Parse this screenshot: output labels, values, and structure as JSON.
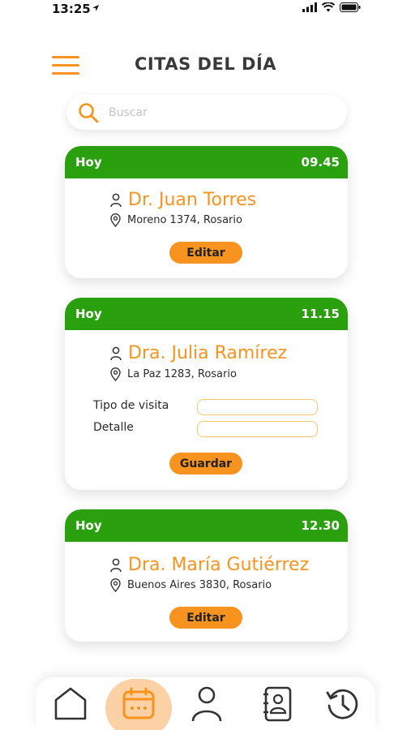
{
  "status": {
    "time": "13:25"
  },
  "header": {
    "title": "CITAS DEL DÍA"
  },
  "search": {
    "placeholder": "Buscar"
  },
  "appointments": [
    {
      "day": "Hoy",
      "time": "09.45",
      "doctor": "Dr. Juan Torres",
      "address": "Moreno 1374, Rosario",
      "button": "Editar"
    },
    {
      "day": "Hoy",
      "time": "11.15",
      "doctor": "Dra. Julia Ramírez",
      "address": "La Paz 1283, Rosario",
      "fields": {
        "visit_type_label": "Tipo de visita",
        "detail_label": "Detalle",
        "visit_type_value": "",
        "detail_value": ""
      },
      "button": "Guardar"
    },
    {
      "day": "Hoy",
      "time": "12.30",
      "doctor": "Dra. María Gutiérrez",
      "address": "Buenos Aires 3830, Rosario",
      "button": "Editar"
    }
  ],
  "nav": {
    "items": [
      {
        "icon": "home-icon"
      },
      {
        "icon": "calendar-icon",
        "active": true
      },
      {
        "icon": "user-icon"
      },
      {
        "icon": "contacts-icon"
      },
      {
        "icon": "history-icon"
      }
    ]
  },
  "colors": {
    "accent": "#f7931e",
    "header_green": "#2aa00f",
    "active_bg": "#fbd1a5"
  }
}
